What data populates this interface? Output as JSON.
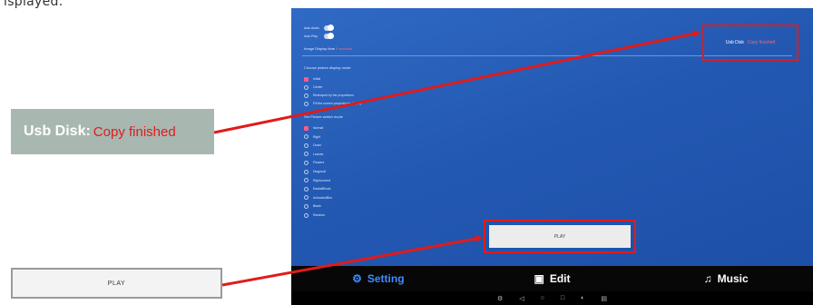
{
  "document": {
    "caption_fragment": "isplayed."
  },
  "callouts": {
    "usb_label": "Usb Disk:",
    "usb_value": "Copy finished",
    "play_label": "PLAY"
  },
  "screen": {
    "toggles": [
      {
        "label": "Auto Audio"
      },
      {
        "label": "Auto Play"
      }
    ],
    "image_display_time": {
      "label": "Image Display time",
      "value": "5 seconds"
    },
    "display_mode": {
      "heading": "Choose picture display mode",
      "options": [
        "Initial",
        "Center",
        "Reshaped by the proportions",
        "Fill the screen proportional display"
      ],
      "selected_index": 0
    },
    "switch_mode": {
      "heading": "Set Picture switch mode",
      "options": [
        "Normal",
        "Right",
        "Down",
        "Leaves",
        "Flowers",
        "Diagonal",
        "Rightcurrent",
        "RadialBlinds",
        "AnimatedBlur",
        "Blank",
        "Random"
      ],
      "selected_index": 0
    },
    "usb_status": {
      "label": "Usb Disk",
      "value": "Copy finished"
    },
    "play_label": "PLAY",
    "tabs": [
      {
        "label": "Setting",
        "icon": "gear-icon",
        "active": true
      },
      {
        "label": "Edit",
        "icon": "image-icon",
        "active": false
      },
      {
        "label": "Music",
        "icon": "music-icon",
        "active": false
      }
    ],
    "system_icons": [
      "settings-icon",
      "back-icon",
      "home-icon",
      "recent-icon",
      "volume-icon",
      "screenshot-icon"
    ]
  },
  "colors": {
    "accent_red": "#e01b1b",
    "active_tab": "#3d8cff",
    "screen_blue": "#2358b2"
  }
}
